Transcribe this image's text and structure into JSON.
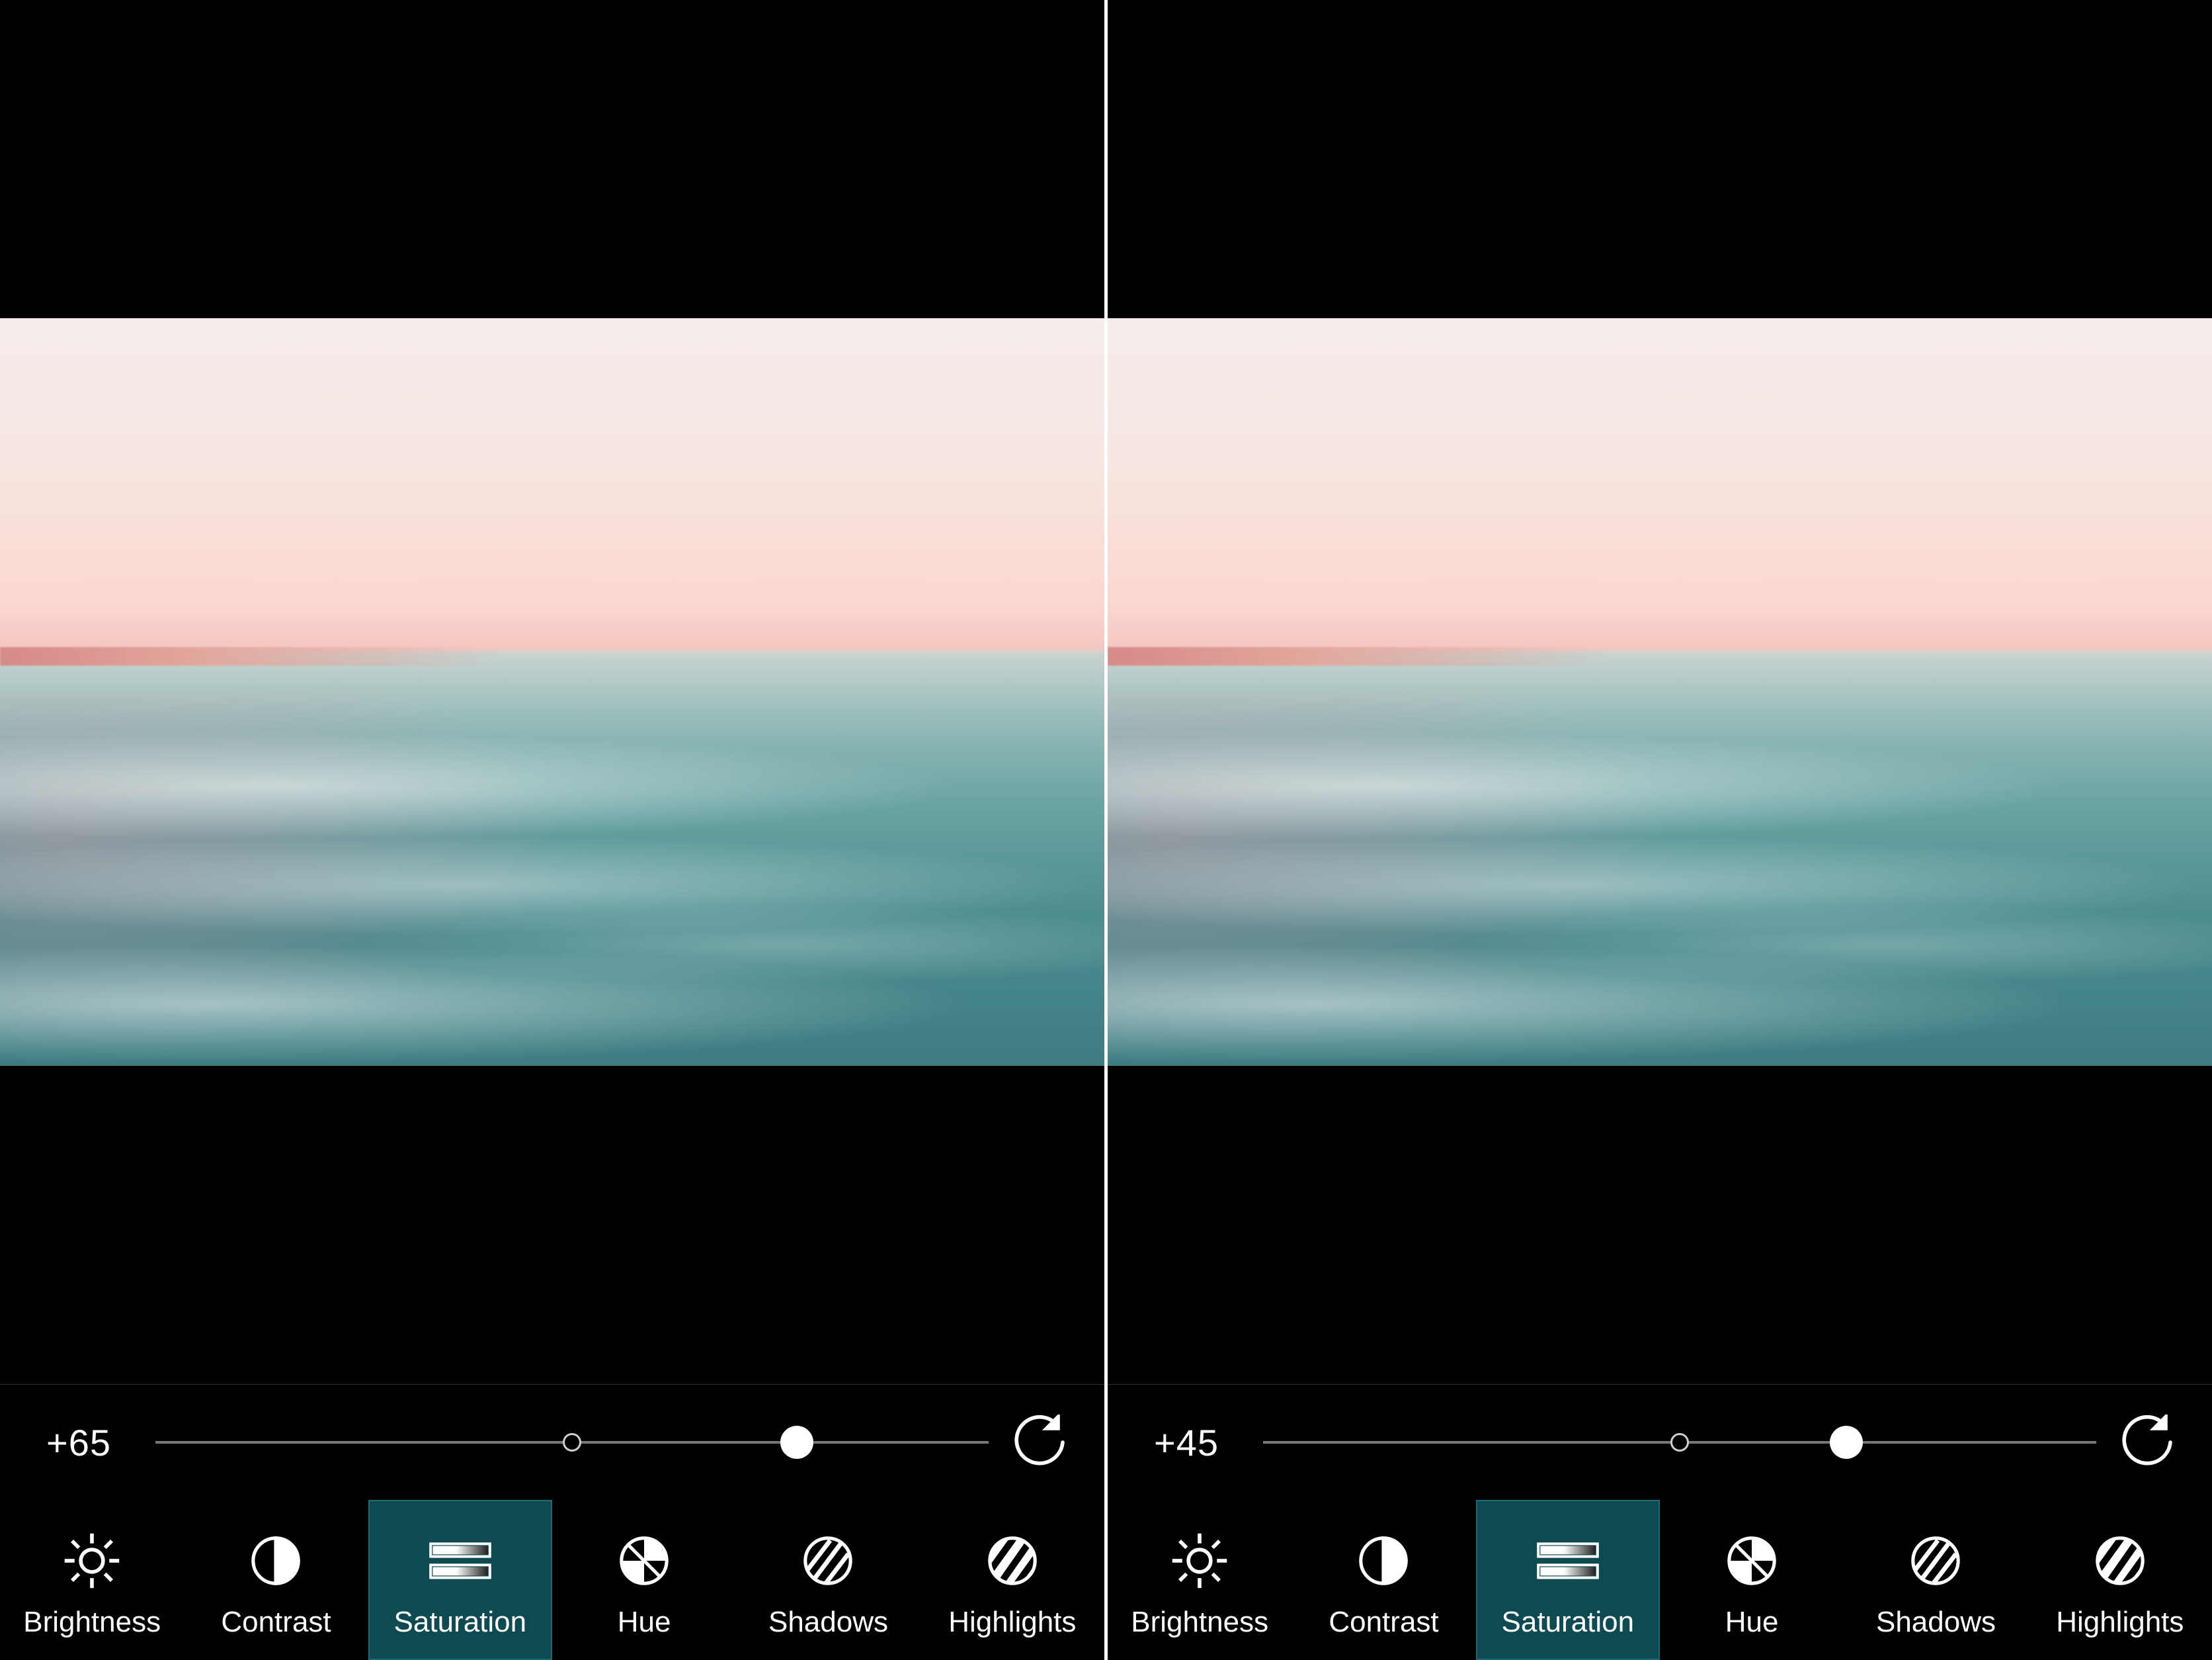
{
  "panels": [
    {
      "slider": {
        "value": 65,
        "display": "+65",
        "pct": 77
      },
      "selected_tool": "saturation",
      "tools": [
        {
          "id": "brightness",
          "label": "Brightness"
        },
        {
          "id": "contrast",
          "label": "Contrast"
        },
        {
          "id": "saturation",
          "label": "Saturation"
        },
        {
          "id": "hue",
          "label": "Hue"
        },
        {
          "id": "shadows",
          "label": "Shadows"
        },
        {
          "id": "highlights",
          "label": "Highlights"
        }
      ]
    },
    {
      "slider": {
        "value": 45,
        "display": "+45",
        "pct": 70
      },
      "selected_tool": "saturation",
      "tools": [
        {
          "id": "brightness",
          "label": "Brightness"
        },
        {
          "id": "contrast",
          "label": "Contrast"
        },
        {
          "id": "saturation",
          "label": "Saturation"
        },
        {
          "id": "hue",
          "label": "Hue"
        },
        {
          "id": "shadows",
          "label": "Shadows"
        },
        {
          "id": "highlights",
          "label": "Highlights"
        }
      ]
    }
  ]
}
